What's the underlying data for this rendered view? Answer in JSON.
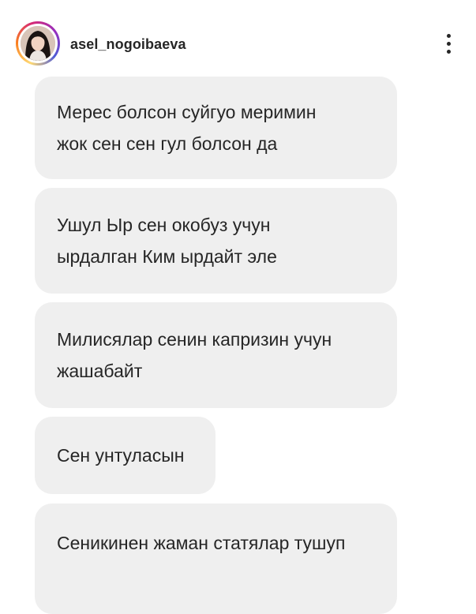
{
  "header": {
    "username": "asel_nogoibaeva",
    "avatar_icon": "profile-photo",
    "menu_icon": "more-vertical-icon",
    "ring_colors": [
      "#feda75",
      "#fa7e1e",
      "#d62976",
      "#962fbf",
      "#4f5bd5"
    ]
  },
  "messages": [
    {
      "text": "Мерес болсон суйгуо меримин жок сен сен гул болсон да"
    },
    {
      "text": "Ушул Ыр сен окобуз учун ырдалган Ким ырдайт эле"
    },
    {
      "text": "Милисялар сенин капризин учун жашабайт"
    },
    {
      "text": "Сен унтуласын"
    },
    {
      "text": "Сеникинен жаман статялар тушуп"
    }
  ],
  "colors": {
    "bubble_bg": "#efefef",
    "text": "#262626"
  }
}
